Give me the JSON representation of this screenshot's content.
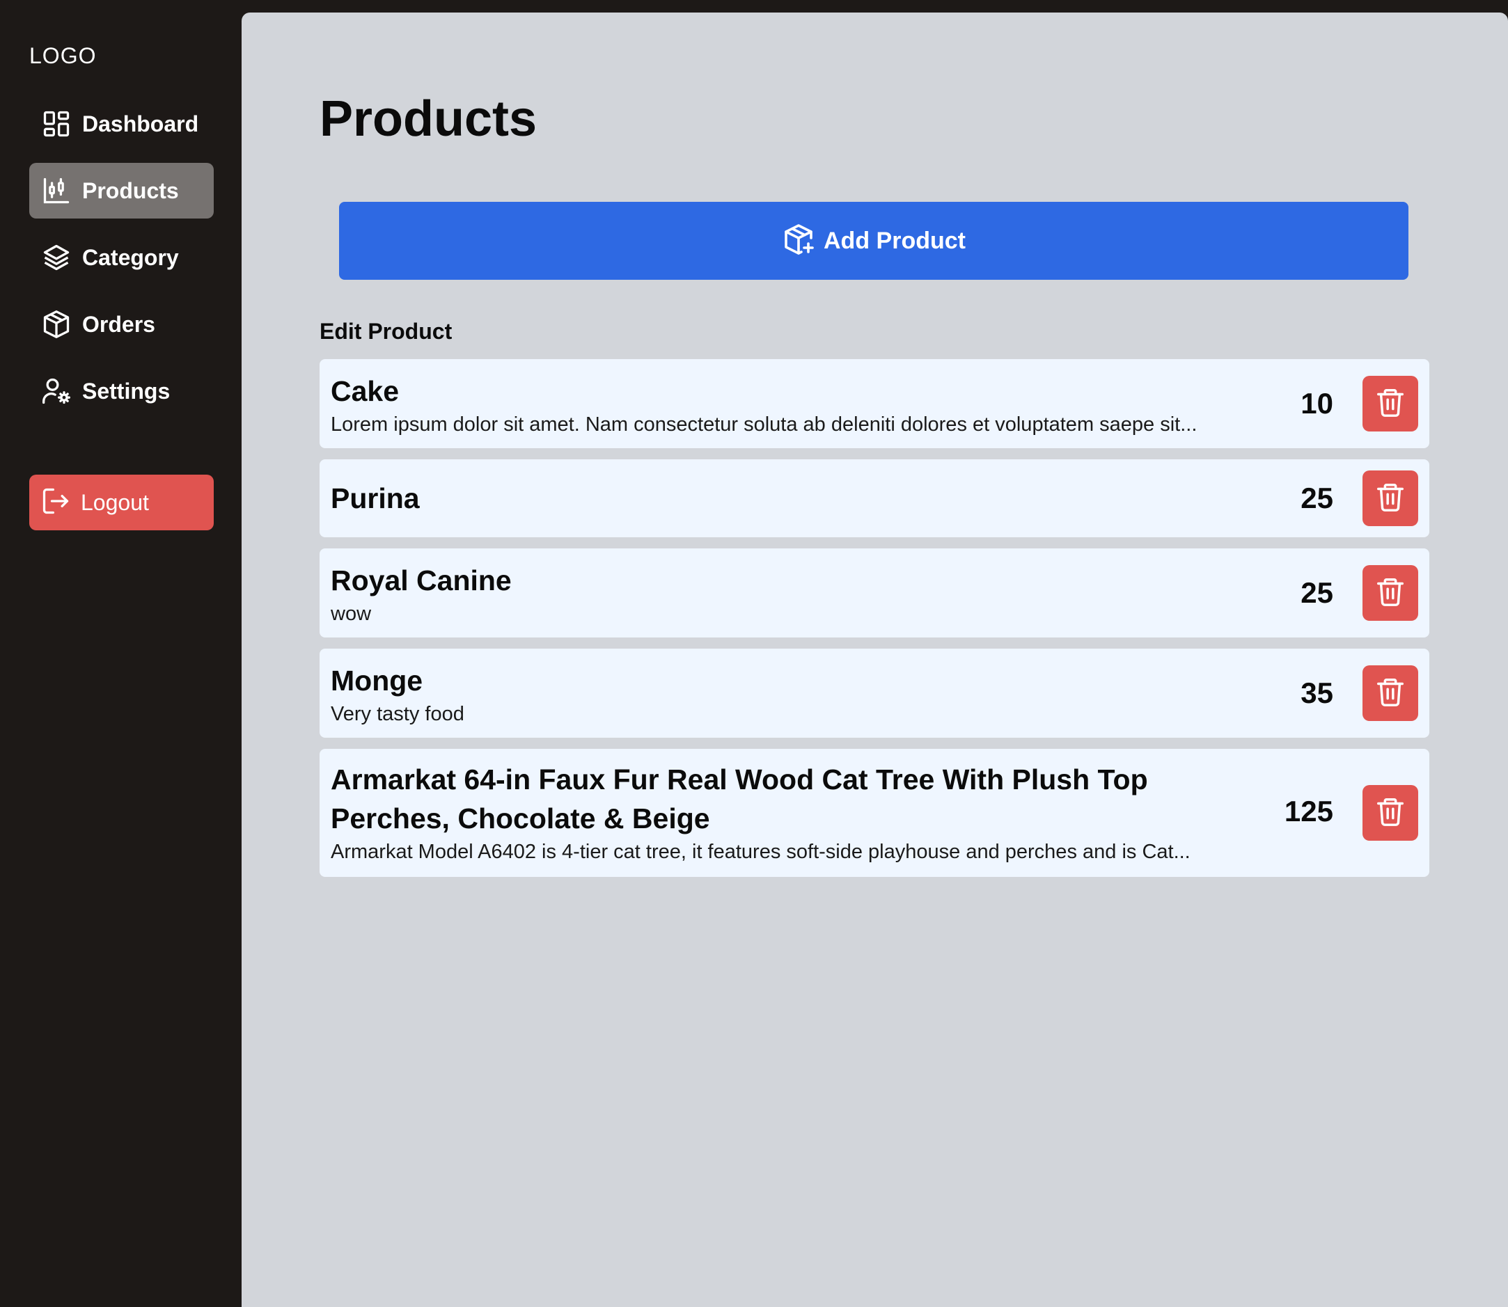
{
  "sidebar": {
    "logo": "LOGO",
    "items": [
      {
        "label": "Dashboard",
        "icon": "dashboard-icon"
      },
      {
        "label": "Products",
        "icon": "chart-candlestick-icon",
        "active": true
      },
      {
        "label": "Category",
        "icon": "layers-icon"
      },
      {
        "label": "Orders",
        "icon": "package-icon"
      },
      {
        "label": "Settings",
        "icon": "user-settings-icon"
      }
    ],
    "logout_label": "Logout"
  },
  "main": {
    "title": "Products",
    "add_button_label": "Add Product",
    "section_label": "Edit Product",
    "products": [
      {
        "name": "Cake",
        "description": "Lorem ipsum dolor sit amet. Nam consectetur soluta ab deleniti dolores et voluptatem saepe sit...",
        "quantity": "10"
      },
      {
        "name": "Purina",
        "description": "",
        "quantity": "25"
      },
      {
        "name": "Royal Canine",
        "description": "wow",
        "quantity": "25"
      },
      {
        "name": "Monge",
        "description": "Very tasty food",
        "quantity": "35"
      },
      {
        "name": "Armarkat 64-in Faux Fur Real Wood Cat Tree With Plush Top Perches, Chocolate & Beige",
        "description": "Armarkat Model A6402 is 4-tier cat tree, it features soft-side playhouse and perches and is Cat...",
        "quantity": "125"
      }
    ]
  },
  "colors": {
    "sidebar_bg": "#1d1917",
    "active_nav_bg": "#767270",
    "main_bg": "#d2d5da",
    "card_bg": "#eff6ff",
    "primary": "#2e69e3",
    "danger": "#e05450"
  }
}
